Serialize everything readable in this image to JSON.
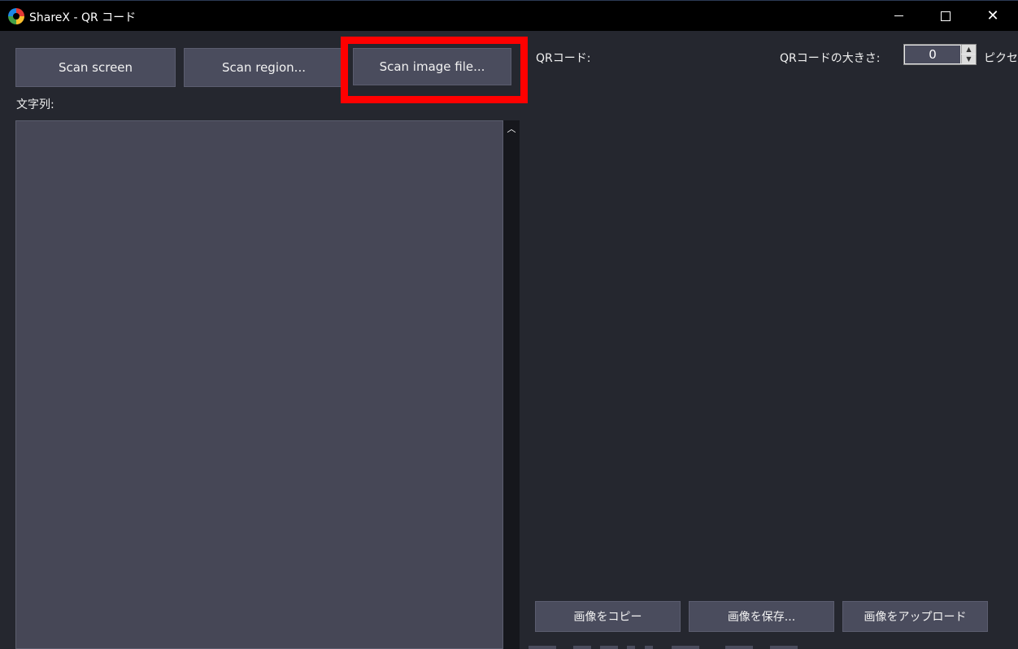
{
  "window": {
    "title": "ShareX - QR コード",
    "minimize_icon": "minimize-icon",
    "maximize_icon": "maximize-icon",
    "close_icon": "close-icon",
    "close_glyph": "✕"
  },
  "scan_buttons": {
    "screen": "Scan screen",
    "region": "Scan region...",
    "image_file": "Scan image file..."
  },
  "left_panel": {
    "text_label": "文字列:",
    "text_value": "",
    "scroll_up_glyph": "︿"
  },
  "right_panel": {
    "qr_label": "QRコード:",
    "size_label": "QRコードの大きさ:",
    "size_value": "0",
    "size_unit": "ピクセル",
    "copy_button": "画像をコピー",
    "save_button": "画像を保存...",
    "upload_button": "画像をアップロード"
  },
  "colors": {
    "window_bg": "#25272f",
    "button_bg": "#4a4c5d",
    "highlight": "#ff0000",
    "titlebar": "#000000"
  }
}
